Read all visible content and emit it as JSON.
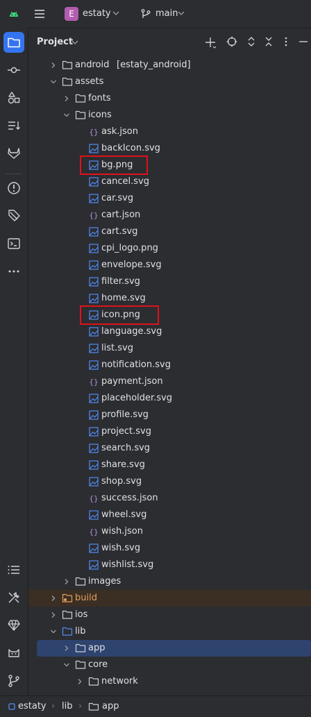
{
  "topbar": {
    "project_badge": "E",
    "project_name": "estaty",
    "branch": "main"
  },
  "panel": {
    "title": "Project"
  },
  "tree": [
    {
      "label": "android",
      "extra": "[estaty_android]",
      "type": "folder",
      "depth": 1,
      "expand": "collapsed"
    },
    {
      "label": "assets",
      "type": "folder",
      "depth": 1,
      "expand": "expanded"
    },
    {
      "label": "fonts",
      "type": "folder",
      "depth": 2,
      "expand": "collapsed"
    },
    {
      "label": "icons",
      "type": "folder",
      "depth": 2,
      "expand": "expanded"
    },
    {
      "label": "ask.json",
      "type": "json",
      "depth": 3
    },
    {
      "label": "backIcon.svg",
      "type": "image",
      "depth": 3
    },
    {
      "label": "bg.png",
      "type": "image",
      "depth": 3
    },
    {
      "label": "cancel.svg",
      "type": "image",
      "depth": 3
    },
    {
      "label": "car.svg",
      "type": "image",
      "depth": 3
    },
    {
      "label": "cart.json",
      "type": "json",
      "depth": 3
    },
    {
      "label": "cart.svg",
      "type": "image",
      "depth": 3
    },
    {
      "label": "cpi_logo.png",
      "type": "image",
      "depth": 3
    },
    {
      "label": "envelope.svg",
      "type": "image",
      "depth": 3
    },
    {
      "label": "filter.svg",
      "type": "image",
      "depth": 3
    },
    {
      "label": "home.svg",
      "type": "image",
      "depth": 3
    },
    {
      "label": "icon.png",
      "type": "image",
      "depth": 3
    },
    {
      "label": "language.svg",
      "type": "image",
      "depth": 3
    },
    {
      "label": "list.svg",
      "type": "image",
      "depth": 3
    },
    {
      "label": "notification.svg",
      "type": "image",
      "depth": 3
    },
    {
      "label": "payment.json",
      "type": "json",
      "depth": 3
    },
    {
      "label": "placeholder.svg",
      "type": "image",
      "depth": 3
    },
    {
      "label": "profile.svg",
      "type": "image",
      "depth": 3
    },
    {
      "label": "project.svg",
      "type": "image",
      "depth": 3
    },
    {
      "label": "search.svg",
      "type": "image",
      "depth": 3
    },
    {
      "label": "share.svg",
      "type": "image",
      "depth": 3
    },
    {
      "label": "shop.svg",
      "type": "image",
      "depth": 3
    },
    {
      "label": "success.json",
      "type": "json",
      "depth": 3
    },
    {
      "label": "wheel.svg",
      "type": "image",
      "depth": 3
    },
    {
      "label": "wish.json",
      "type": "json",
      "depth": 3
    },
    {
      "label": "wish.svg",
      "type": "image",
      "depth": 3
    },
    {
      "label": "wishlist.svg",
      "type": "image",
      "depth": 3
    },
    {
      "label": "images",
      "type": "folder",
      "depth": 2,
      "expand": "collapsed"
    },
    {
      "label": "build",
      "type": "folder-excluded",
      "depth": 1,
      "expand": "collapsed",
      "state": "excluded"
    },
    {
      "label": "ios",
      "type": "folder",
      "depth": 1,
      "expand": "collapsed"
    },
    {
      "label": "lib",
      "type": "folder-source",
      "depth": 1,
      "expand": "expanded"
    },
    {
      "label": "app",
      "type": "folder",
      "depth": 2,
      "expand": "collapsed",
      "state": "selected"
    },
    {
      "label": "core",
      "type": "folder",
      "depth": 2,
      "expand": "expanded"
    },
    {
      "label": "network",
      "type": "folder",
      "depth": 3,
      "expand": "collapsed"
    }
  ],
  "highlighted_items": [
    "bg.png",
    "icon.png"
  ],
  "statusbar": {
    "breadcrumbs": [
      "estaty",
      "lib",
      "app"
    ]
  },
  "colors": {
    "background": "#2b2d30",
    "selection": "#2e436e",
    "accent": "#3574f0",
    "excluded_row": "#3b2e23",
    "highlight_box": "#e0121c",
    "project_badge": "#b35db0"
  }
}
